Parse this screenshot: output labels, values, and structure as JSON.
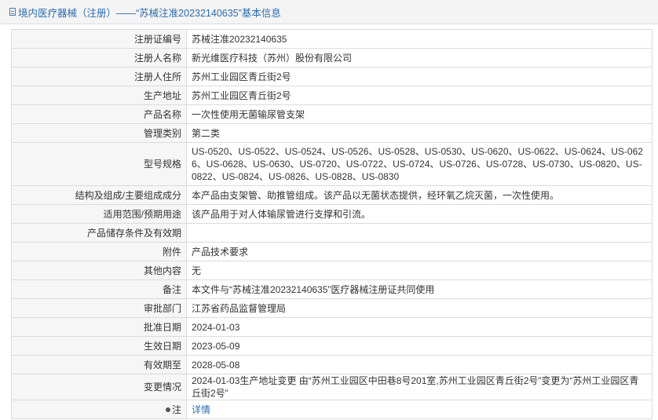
{
  "header": {
    "title": "境内医疗器械（注册）——“苏械注准20232140635”基本信息"
  },
  "rows": [
    {
      "label": "注册证编号",
      "value": "苏械注准20232140635"
    },
    {
      "label": "注册人名称",
      "value": "新光维医疗科技（苏州）股份有限公司"
    },
    {
      "label": "注册人住所",
      "value": "苏州工业园区青丘街2号"
    },
    {
      "label": "生产地址",
      "value": "苏州工业园区青丘街2号"
    },
    {
      "label": "产品名称",
      "value": "一次性使用无菌输尿管支架"
    },
    {
      "label": "管理类别",
      "value": "第二类"
    },
    {
      "label": "型号规格",
      "value": "US-0520、US-0522、US-0524、US-0526、US-0528、US-0530、US-0620、US-0622、US-0624、US-0626、US-0628、US-0630、US-0720、US-0722、US-0724、US-0726、US-0728、US-0730、US-0820、US-0822、US-0824、US-0826、US-0828、US-0830"
    },
    {
      "label": "结构及组成/主要组成成分",
      "value": "本产品由支架管、助推管组成。该产品以无菌状态提供，经环氧乙烷灭菌，一次性使用。"
    },
    {
      "label": "适用范围/预期用途",
      "value": "该产品用于对人体输尿管进行支撑和引流。"
    },
    {
      "label": "产品储存条件及有效期",
      "value": ""
    },
    {
      "label": "附件",
      "value": "产品技术要求"
    },
    {
      "label": "其他内容",
      "value": "无"
    },
    {
      "label": "备注",
      "value": "本文件与“苏械注准20232140635”医疗器械注册证共同使用"
    },
    {
      "label": "审批部门",
      "value": "江苏省药品监督管理局"
    },
    {
      "label": "批准日期",
      "value": "2024-01-03"
    },
    {
      "label": "生效日期",
      "value": "2023-05-09"
    },
    {
      "label": "有效期至",
      "value": "2028-05-08"
    },
    {
      "label": "变更情况",
      "value": "2024-01-03生产地址变更 由“苏州工业园区中田巷8号201室,苏州工业园区青丘街2号”变更为“苏州工业园区青丘街2号”"
    }
  ],
  "note": {
    "label": "注",
    "icon": "note-icon",
    "link_text": "详情"
  },
  "colors": {
    "header_text": "#2b6cb0",
    "label_bg": "#f6f6f6",
    "border": "#dbdbdb"
  }
}
